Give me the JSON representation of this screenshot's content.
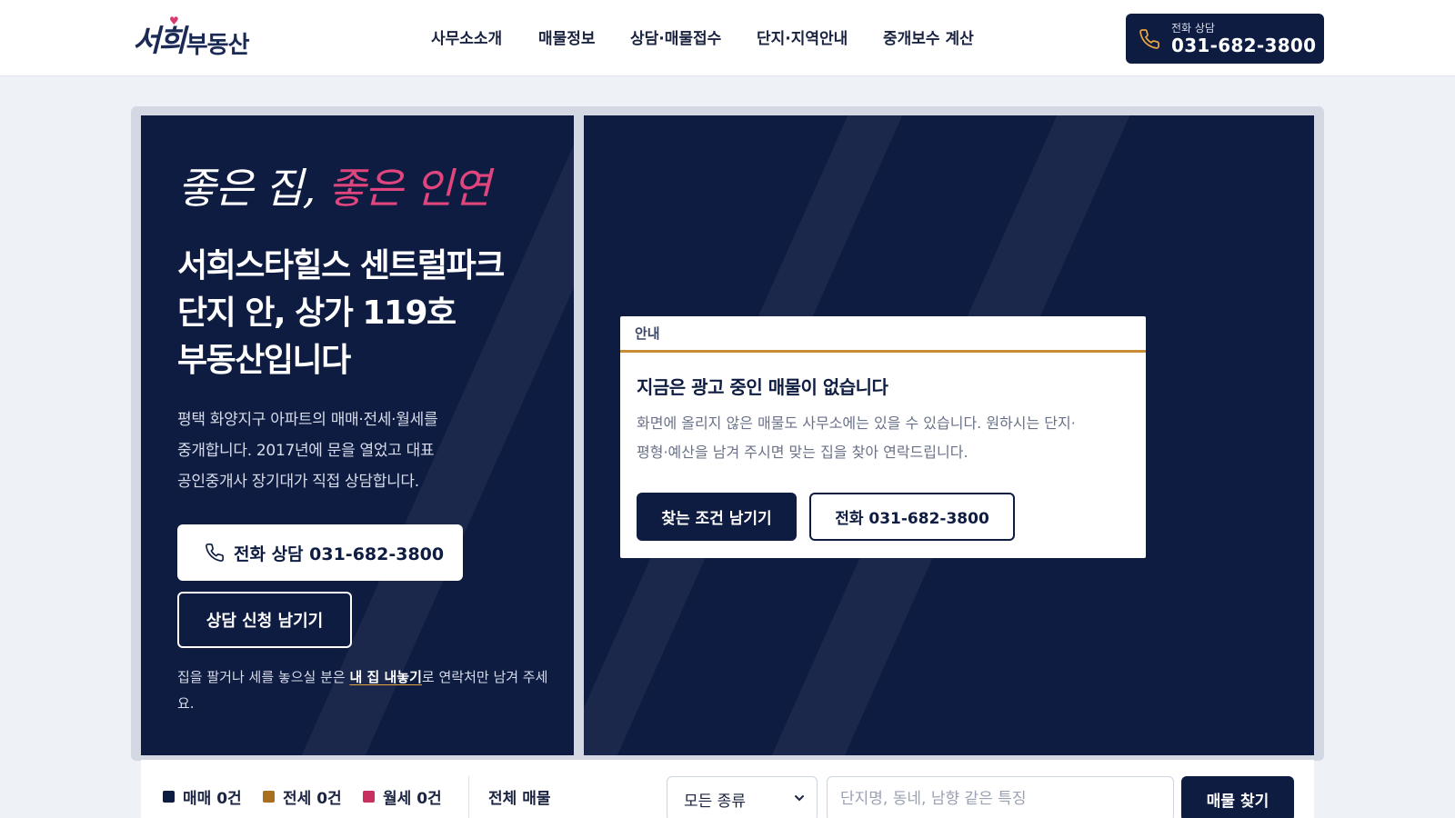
{
  "header": {
    "logo_script": "서희",
    "logo_bold": "부동산",
    "nav": [
      "사무소소개",
      "매물정보",
      "상담·매물접수",
      "단지·지역안내",
      "중개보수 계산"
    ],
    "call_small": "전화 상담",
    "call_number": "031-682-3800"
  },
  "hero": {
    "slogan_white": "좋은 집, ",
    "slogan_pink": "좋은 인연",
    "title_lines": [
      "서희스타힐스 센트럴파크",
      "단지 안, 상가 119호",
      "부동산입니다"
    ],
    "desc_lines": [
      "평택 화양지구 아파트의 매매·전세·월세를",
      "중개합니다. 2017년에 문을 열었고 대표",
      "공인중개사 장기대가 직접 상담합니다."
    ],
    "call_button": "전화 상담 031-682-3800",
    "consult_button": "상담 신청 남기기",
    "note_before": "집을 팔거나 세를 놓으실 분은 ",
    "note_link": "내 집 내놓기",
    "note_after": "로 연락처만 남겨 주세요."
  },
  "notice": {
    "header": "안내",
    "title": "지금은 광고 중인 매물이 없습니다",
    "body_lines": [
      "화면에 올리지 않은 매물도 사무소에는 있을 수 있습니다. 원하시는 단지·",
      "평형·예산을 남겨 주시면 맞는 집을 찾아 연락드립니다."
    ],
    "primary_button": "찾는 조건 남기기",
    "phone_button": "전화 031-682-3800"
  },
  "search": {
    "legend": [
      {
        "label": "매매",
        "count": "0건",
        "color": "#0f1c42"
      },
      {
        "label": "전세",
        "count": "0건",
        "color": "#a86f1e"
      },
      {
        "label": "월세",
        "count": "0건",
        "color": "#c7305f"
      }
    ],
    "all_label": "전체 매물",
    "select_value": "모든 종류",
    "input_placeholder": "단지명, 동네, 남향 같은 특징",
    "button": "매물 찾기"
  },
  "colors": {
    "navy": "#0f1c42",
    "accent_pink": "#e0457e",
    "accent_gold": "#c88e36"
  },
  "icons": [
    "phone-icon",
    "chevron-down-icon",
    "heart-icon"
  ]
}
